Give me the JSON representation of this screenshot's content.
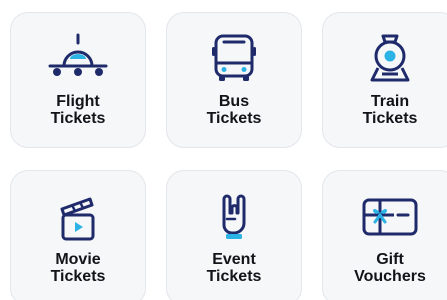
{
  "colors": {
    "icon_navy": "#1f2a6b",
    "icon_accent": "#2bb3e6",
    "tile_bg": "#f6f7f9",
    "label_text": "#111418"
  },
  "tiles": [
    {
      "icon": "airplane-icon",
      "line1": "Flight",
      "line2": "Tickets"
    },
    {
      "icon": "bus-icon",
      "line1": "Bus",
      "line2": "Tickets"
    },
    {
      "icon": "train-icon",
      "line1": "Train",
      "line2": "Tickets"
    },
    {
      "icon": "clapperboard-icon",
      "line1": "Movie",
      "line2": "Tickets"
    },
    {
      "icon": "rock-hand-icon",
      "line1": "Event",
      "line2": "Tickets"
    },
    {
      "icon": "gift-card-icon",
      "line1": "Gift",
      "line2": "Vouchers"
    }
  ]
}
